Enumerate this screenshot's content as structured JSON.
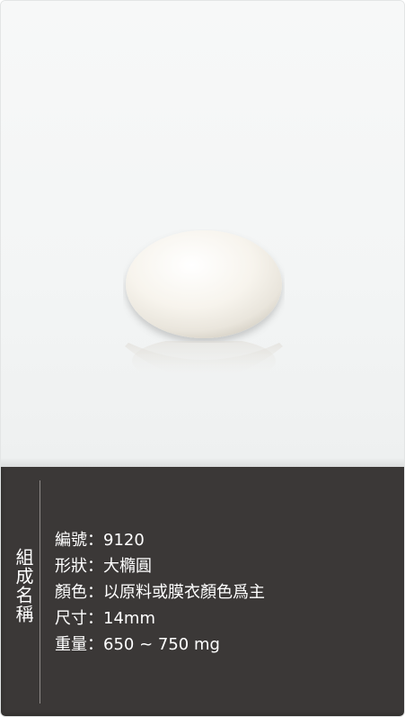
{
  "product": {
    "image_alt": "white oval tablet",
    "colors": {
      "photo_background": "#f4f6f6",
      "tablet": "#f6f3ec",
      "panel_background": "#3b3837",
      "text": "#ffffff"
    }
  },
  "info_panel": {
    "section_label": "組成名稱",
    "specs": [
      {
        "label": "編號",
        "separator": "：",
        "value": "9120"
      },
      {
        "label": "形狀",
        "separator": "：",
        "value": "大橢圓"
      },
      {
        "label": "顏色",
        "separator": "：",
        "value": "以原料或膜衣顏色爲主"
      },
      {
        "label": "尺寸",
        "separator": "：",
        "value": "14mm"
      },
      {
        "label": "重量",
        "separator": "：",
        "value": "650 ~ 750 mg"
      }
    ]
  }
}
